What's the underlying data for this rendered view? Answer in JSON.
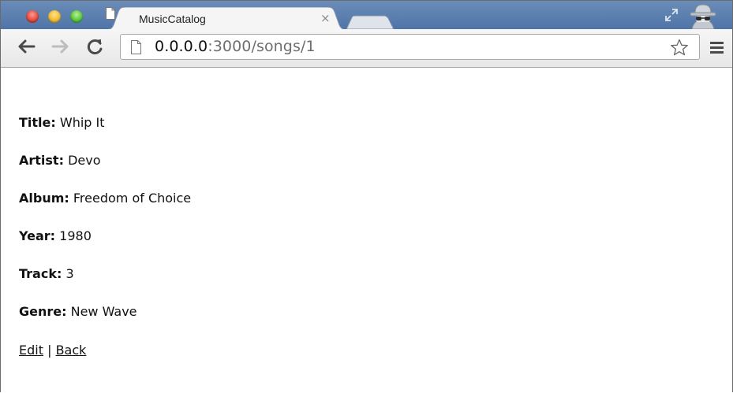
{
  "window": {
    "tab_title": "MusicCatalog",
    "tab_close": "×",
    "url_host": "0.0.0.0",
    "url_rest": ":3000/songs/1",
    "icons": [
      "close-window",
      "minimize-window",
      "zoom-window",
      "page-icon",
      "new-tab",
      "fullscreen-icon",
      "incognito-icon",
      "back-arrow-icon",
      "forward-arrow-icon",
      "reload-icon",
      "star-icon",
      "menu-icon"
    ],
    "colors": {
      "titlebar": "#5a7fb0",
      "toolbar": "#eeeeee"
    }
  },
  "song": {
    "title_label": "Title:",
    "title_value": "Whip It",
    "artist_label": "Artist:",
    "artist_value": "Devo",
    "album_label": "Album:",
    "album_value": "Freedom of Choice",
    "year_label": "Year:",
    "year_value": "1980",
    "track_label": "Track:",
    "track_value": "3",
    "genre_label": "Genre:",
    "genre_value": "New Wave"
  },
  "links": {
    "edit": "Edit",
    "separator": "|",
    "back": "Back"
  }
}
